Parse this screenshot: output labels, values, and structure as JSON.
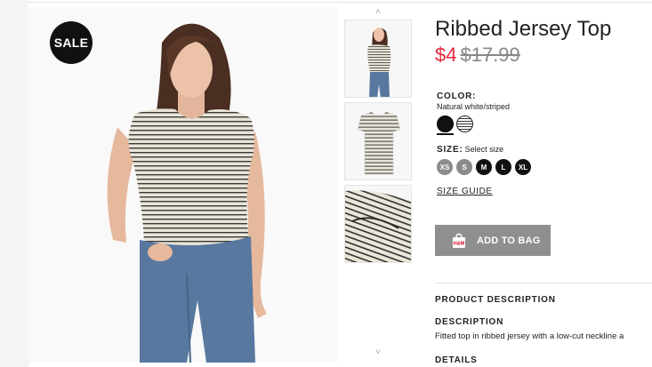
{
  "badge": {
    "sale": "SALE"
  },
  "product": {
    "title": "Ribbed Jersey Top",
    "price_sale": "$4",
    "price_original": "$17.99"
  },
  "color": {
    "label": "COLOR:",
    "value": "Natural white/striped",
    "swatches": [
      "black",
      "natural-white-striped"
    ],
    "selected": "natural-white-striped"
  },
  "size": {
    "label": "SIZE:",
    "hint": "Select size",
    "options": [
      {
        "label": "XS",
        "available": false
      },
      {
        "label": "S",
        "available": false
      },
      {
        "label": "M",
        "available": true
      },
      {
        "label": "L",
        "available": true
      },
      {
        "label": "XL",
        "available": true
      }
    ]
  },
  "size_guide": "SIZE GUIDE",
  "add_to_bag": {
    "label": "ADD TO BAG",
    "icon_text": "H&M"
  },
  "sections": {
    "product_description": "PRODUCT DESCRIPTION",
    "description": "DESCRIPTION",
    "description_text": "Fitted top in ribbed jersey with a low-cut neckline a",
    "details": "DETAILS"
  },
  "thumbnails": {
    "up_arrow": "˄",
    "down_arrow": "˅",
    "items": [
      "model-front",
      "flat-lay",
      "fabric-detail"
    ]
  },
  "colors": {
    "sale_price": "#e5293f",
    "button": "#8f8f8f",
    "badge": "#111111"
  }
}
